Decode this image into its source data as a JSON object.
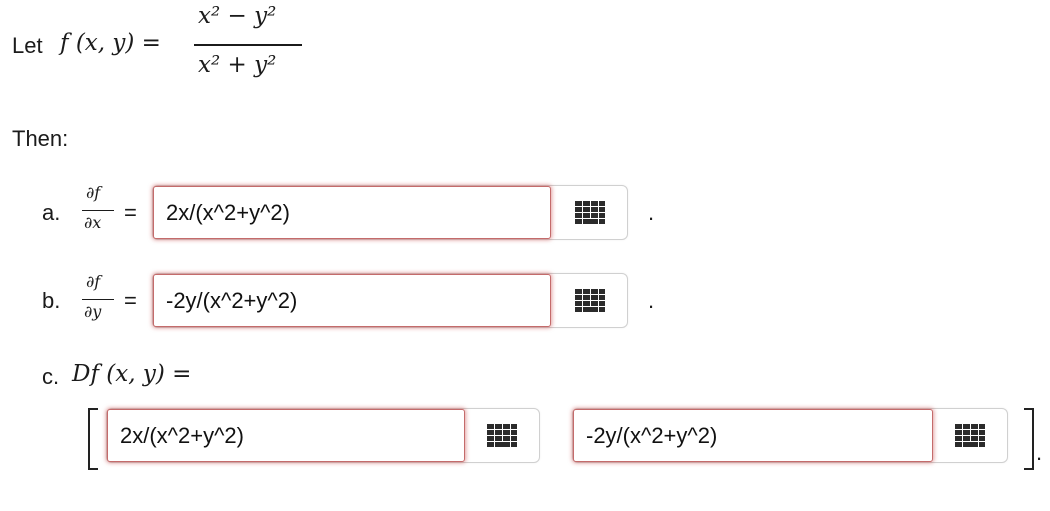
{
  "problem": {
    "let_word": "Let",
    "f_lhs": "f (x, y) =",
    "numerator": "x² − y²",
    "denominator": "x² + y²",
    "then_label": "Then:"
  },
  "part_a": {
    "label": "a.",
    "partial_num": "∂f",
    "partial_den": "∂x",
    "equals": "=",
    "answer_value": "2x/(x^2+y^2)",
    "trailing": "."
  },
  "part_b": {
    "label": "b.",
    "partial_num": "∂f",
    "partial_den": "∂y",
    "equals": "=",
    "answer_value": "-2y/(x^2+y^2)",
    "trailing": "."
  },
  "part_c": {
    "label": "c.",
    "lhs": "Df (x, y) =",
    "entry1_value": "2x/(x^2+y^2)",
    "entry2_value": "-2y/(x^2+y^2)",
    "trailing": "."
  },
  "icons": {
    "keypad": "keypad-grid-icon"
  },
  "colors": {
    "field_error_border": "#c46b6b",
    "text": "#1b1b1b"
  }
}
